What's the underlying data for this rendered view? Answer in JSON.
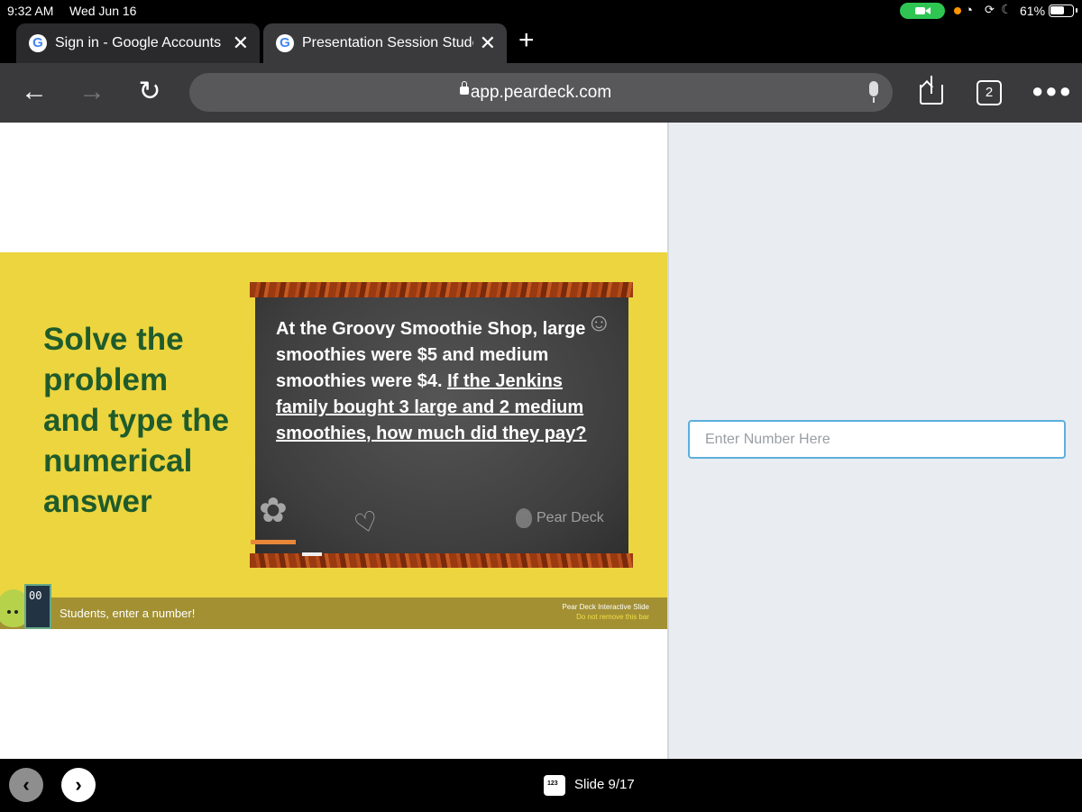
{
  "status": {
    "time": "9:32 AM",
    "date": "Wed Jun 16",
    "battery": "61%"
  },
  "tabs": [
    {
      "title": "Sign in - Google Accounts",
      "active": false
    },
    {
      "title": "Presentation Session Student",
      "active": true
    }
  ],
  "toolbar": {
    "url": "app.peardeck.com",
    "tab_count": "2"
  },
  "slide": {
    "prompt_lines": [
      "Solve the",
      "problem",
      "and type the",
      "numerical",
      "answer"
    ],
    "board_text_plain": "At the Groovy Smoothie Shop, large smoothies were $5 and medium smoothies were $4.",
    "board_text_underlined": "If the Jenkins family bought 3 large and 2 medium smoothies, how much did they pay?",
    "watermark": "Pear Deck",
    "footer_text": "Students, enter a number!",
    "footer_brand": "Pear Deck Interactive Slide",
    "footer_brand_sub": "Do not remove this bar",
    "pear_screen": "00"
  },
  "answer": {
    "placeholder": "Enter Number Here",
    "value": ""
  },
  "bottom": {
    "slide_icon_text": "123",
    "slide_label": "Slide 9/17"
  },
  "icons": [
    "back-arrow-icon",
    "forward-arrow-icon",
    "reload-icon",
    "lock-icon",
    "microphone-icon",
    "share-icon",
    "more-icon",
    "chevron-left-icon",
    "chevron-right-icon"
  ],
  "colors": {
    "slide_bg": "#ecd53f",
    "prompt_text": "#1f5b2b",
    "footer_bar": "#a29033",
    "input_border": "#5bb0de",
    "right_pane_bg": "#e9ecf0"
  }
}
